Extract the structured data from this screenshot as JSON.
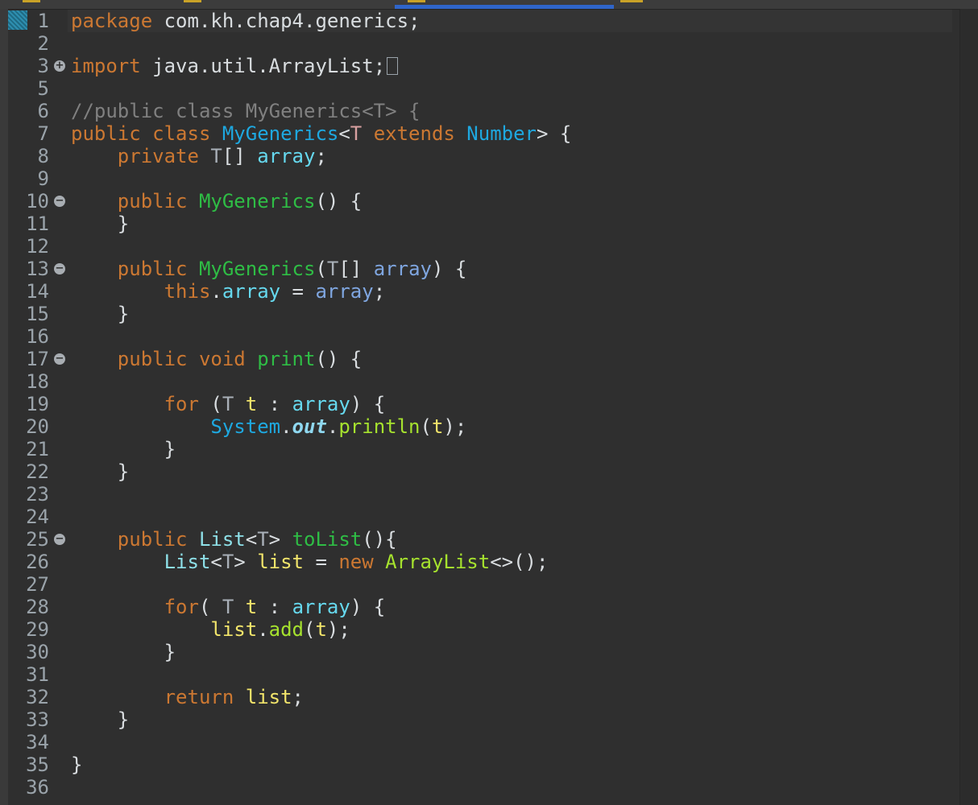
{
  "editor": {
    "language": "java",
    "colors": {
      "background": "#2f2f2f",
      "keyword": "#cc7832",
      "plain": "#d9dde0",
      "comment": "#808080",
      "class": "#1ea8e0",
      "type": "#a9b0b8",
      "field": "#66d9ef",
      "param": "#7fa6e0",
      "method_decl": "#2fbd45",
      "method": "#a6e22e",
      "local": "#f2e56b",
      "line_number": "#9aa3aa"
    },
    "lines": [
      {
        "n": "1",
        "tokens": [
          {
            "t": "package",
            "c": "keyword"
          },
          {
            "t": " com.kh.chap4.generics;",
            "c": "plain"
          }
        ]
      },
      {
        "n": "2",
        "tokens": []
      },
      {
        "n": "3",
        "fold": "+",
        "tokens": [
          {
            "t": "import",
            "c": "keyword"
          },
          {
            "t": " java.util.ArrayList;",
            "c": "plain"
          }
        ],
        "collapsed_marker": ".."
      },
      {
        "n": "5",
        "tokens": []
      },
      {
        "n": "6",
        "tokens": [
          {
            "t": "//public class MyGenerics<T> {",
            "c": "comment"
          }
        ]
      },
      {
        "n": "7",
        "tokens": [
          {
            "t": "public class ",
            "c": "keyword"
          },
          {
            "t": "MyGenerics",
            "c": "class"
          },
          {
            "t": "<",
            "c": "plain"
          },
          {
            "t": "T",
            "c": "type-decl"
          },
          {
            "t": " extends ",
            "c": "keyword"
          },
          {
            "t": "Number",
            "c": "class"
          },
          {
            "t": "> {",
            "c": "plain"
          }
        ]
      },
      {
        "n": "8",
        "tokens": [
          {
            "t": "    private ",
            "c": "keyword"
          },
          {
            "t": "T",
            "c": "type"
          },
          {
            "t": "[] ",
            "c": "plain"
          },
          {
            "t": "array",
            "c": "field"
          },
          {
            "t": ";",
            "c": "plain"
          }
        ]
      },
      {
        "n": "9",
        "tokens": []
      },
      {
        "n": "10",
        "fold": "−",
        "tokens": [
          {
            "t": "    public ",
            "c": "keyword"
          },
          {
            "t": "MyGenerics",
            "c": "method-decl"
          },
          {
            "t": "() {",
            "c": "plain"
          }
        ]
      },
      {
        "n": "11",
        "tokens": [
          {
            "t": "    }",
            "c": "plain"
          }
        ]
      },
      {
        "n": "12",
        "tokens": []
      },
      {
        "n": "13",
        "fold": "−",
        "tokens": [
          {
            "t": "    public ",
            "c": "keyword"
          },
          {
            "t": "MyGenerics",
            "c": "method-decl"
          },
          {
            "t": "(",
            "c": "plain"
          },
          {
            "t": "T",
            "c": "type"
          },
          {
            "t": "[] ",
            "c": "plain"
          },
          {
            "t": "array",
            "c": "param"
          },
          {
            "t": ") {",
            "c": "plain"
          }
        ]
      },
      {
        "n": "14",
        "tokens": [
          {
            "t": "        this",
            "c": "keyword"
          },
          {
            "t": ".",
            "c": "plain"
          },
          {
            "t": "array",
            "c": "field"
          },
          {
            "t": " = ",
            "c": "plain"
          },
          {
            "t": "array",
            "c": "param"
          },
          {
            "t": ";",
            "c": "plain"
          }
        ]
      },
      {
        "n": "15",
        "tokens": [
          {
            "t": "    }",
            "c": "plain"
          }
        ]
      },
      {
        "n": "16",
        "tokens": []
      },
      {
        "n": "17",
        "fold": "−",
        "tokens": [
          {
            "t": "    public void ",
            "c": "keyword"
          },
          {
            "t": "print",
            "c": "method-decl"
          },
          {
            "t": "() {",
            "c": "plain"
          }
        ]
      },
      {
        "n": "18",
        "tokens": []
      },
      {
        "n": "19",
        "tokens": [
          {
            "t": "        for ",
            "c": "keyword"
          },
          {
            "t": "(",
            "c": "plain"
          },
          {
            "t": "T",
            "c": "type"
          },
          {
            "t": " ",
            "c": "plain"
          },
          {
            "t": "t",
            "c": "local"
          },
          {
            "t": " : ",
            "c": "plain"
          },
          {
            "t": "array",
            "c": "field"
          },
          {
            "t": ") {",
            "c": "plain"
          }
        ]
      },
      {
        "n": "20",
        "tokens": [
          {
            "t": "            ",
            "c": "plain"
          },
          {
            "t": "System",
            "c": "class"
          },
          {
            "t": ".",
            "c": "plain"
          },
          {
            "t": "out",
            "c": "static-field"
          },
          {
            "t": ".",
            "c": "plain"
          },
          {
            "t": "println",
            "c": "method"
          },
          {
            "t": "(",
            "c": "plain"
          },
          {
            "t": "t",
            "c": "local"
          },
          {
            "t": ");",
            "c": "plain"
          }
        ]
      },
      {
        "n": "21",
        "tokens": [
          {
            "t": "        }",
            "c": "plain"
          }
        ]
      },
      {
        "n": "22",
        "tokens": [
          {
            "t": "    }",
            "c": "plain"
          }
        ]
      },
      {
        "n": "23",
        "tokens": []
      },
      {
        "n": "24",
        "tokens": []
      },
      {
        "n": "25",
        "fold": "−",
        "tokens": [
          {
            "t": "    public ",
            "c": "keyword"
          },
          {
            "t": "List",
            "c": "iface"
          },
          {
            "t": "<",
            "c": "plain"
          },
          {
            "t": "T",
            "c": "type"
          },
          {
            "t": "> ",
            "c": "plain"
          },
          {
            "t": "toList",
            "c": "method-decl"
          },
          {
            "t": "(){",
            "c": "plain"
          }
        ]
      },
      {
        "n": "26",
        "tokens": [
          {
            "t": "        ",
            "c": "plain"
          },
          {
            "t": "List",
            "c": "iface"
          },
          {
            "t": "<",
            "c": "plain"
          },
          {
            "t": "T",
            "c": "type"
          },
          {
            "t": "> ",
            "c": "plain"
          },
          {
            "t": "list",
            "c": "local"
          },
          {
            "t": " = ",
            "c": "plain"
          },
          {
            "t": "new ",
            "c": "keyword"
          },
          {
            "t": "ArrayList",
            "c": "method"
          },
          {
            "t": "<>();",
            "c": "plain"
          }
        ]
      },
      {
        "n": "27",
        "tokens": []
      },
      {
        "n": "28",
        "tokens": [
          {
            "t": "        for",
            "c": "keyword"
          },
          {
            "t": "( ",
            "c": "plain"
          },
          {
            "t": "T",
            "c": "type"
          },
          {
            "t": " ",
            "c": "plain"
          },
          {
            "t": "t",
            "c": "local"
          },
          {
            "t": " : ",
            "c": "plain"
          },
          {
            "t": "array",
            "c": "field"
          },
          {
            "t": ") {",
            "c": "plain"
          }
        ]
      },
      {
        "n": "29",
        "tokens": [
          {
            "t": "            ",
            "c": "plain"
          },
          {
            "t": "list",
            "c": "local"
          },
          {
            "t": ".",
            "c": "plain"
          },
          {
            "t": "add",
            "c": "method"
          },
          {
            "t": "(",
            "c": "plain"
          },
          {
            "t": "t",
            "c": "local"
          },
          {
            "t": ");",
            "c": "plain"
          }
        ]
      },
      {
        "n": "30",
        "tokens": [
          {
            "t": "        }",
            "c": "plain"
          }
        ]
      },
      {
        "n": "31",
        "tokens": []
      },
      {
        "n": "32",
        "tokens": [
          {
            "t": "        return ",
            "c": "keyword"
          },
          {
            "t": "list",
            "c": "local"
          },
          {
            "t": ";",
            "c": "plain"
          }
        ]
      },
      {
        "n": "33",
        "tokens": [
          {
            "t": "    }",
            "c": "plain"
          }
        ]
      },
      {
        "n": "34",
        "tokens": []
      },
      {
        "n": "35",
        "tokens": [
          {
            "t": "}",
            "c": "plain"
          }
        ]
      },
      {
        "n": "36",
        "tokens": []
      }
    ]
  }
}
